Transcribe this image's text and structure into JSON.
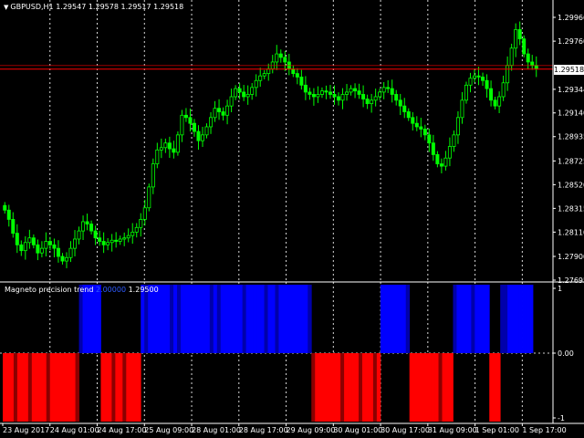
{
  "header": {
    "symbol": "GBPUSD,H1",
    "open": "1.29547",
    "high": "1.29578",
    "low": "1.29517",
    "close": "1.29518"
  },
  "indicator": {
    "name": "Magneto precision trend",
    "value1": "2.00000",
    "value2": "1.29500"
  },
  "current_price": "1.29518",
  "colors": {
    "background": "#000000",
    "bull_candle": "#00ff00",
    "bear_candle": "#00ff00",
    "grid": "#ffffff",
    "bid_line": "#ff0000",
    "up_bar": "#0000ff",
    "up_bar_dark": "#0000aa",
    "down_bar": "#ff0000",
    "down_bar_dark": "#8b0000"
  },
  "chart_data": [
    {
      "type": "candlestick",
      "title": "GBPUSD,H1",
      "y_ticks": [
        "1.29966",
        "1.29760",
        "1.29518",
        "1.29344",
        "1.29140",
        "1.28935",
        "1.28725",
        "1.28520",
        "1.28315",
        "1.28110",
        "1.27900",
        "1.27695"
      ],
      "y_tick_values": [
        1.29966,
        1.2976,
        1.29344,
        1.2914,
        1.28935,
        1.28725,
        1.2852,
        1.28315,
        1.2811,
        1.279,
        1.27695
      ],
      "ylim": [
        1.27695,
        1.301
      ],
      "x_labels": [
        "23 Aug 2017",
        "24 Aug 01:00",
        "24 Aug 17:00",
        "25 Aug 09:00",
        "28 Aug 01:00",
        "28 Aug 17:00",
        "29 Aug 09:00",
        "30 Aug 01:00",
        "30 Aug 17:00",
        "31 Aug 09:00",
        "1 Sep 01:00",
        "1 Sep 17:00"
      ],
      "bid_price": 1.29518,
      "close": [
        1.283,
        1.2822,
        1.281,
        1.28,
        1.2795,
        1.2802,
        1.2806,
        1.28,
        1.2793,
        1.2797,
        1.2803,
        1.28,
        1.2797,
        1.279,
        1.2786,
        1.2789,
        1.2797,
        1.2805,
        1.2812,
        1.282,
        1.2818,
        1.2812,
        1.2806,
        1.2803,
        1.28,
        1.2802,
        1.2804,
        1.2803,
        1.2805,
        1.2806,
        1.2808,
        1.2811,
        1.2815,
        1.2822,
        1.2832,
        1.285,
        1.287,
        1.2882,
        1.2884,
        1.2888,
        1.2883,
        1.288,
        1.2895,
        1.2912,
        1.291,
        1.2905,
        1.2898,
        1.289,
        1.2895,
        1.2902,
        1.291,
        1.2918,
        1.2915,
        1.2912,
        1.292,
        1.2928,
        1.2935,
        1.2932,
        1.2928,
        1.293,
        1.2936,
        1.2942,
        1.2946,
        1.2948,
        1.2952,
        1.2958,
        1.2965,
        1.2962,
        1.2958,
        1.2952,
        1.2948,
        1.2945,
        1.2938,
        1.2932,
        1.293,
        1.2928,
        1.293,
        1.2933,
        1.2932,
        1.293,
        1.2928,
        1.2925,
        1.293,
        1.2932,
        1.2935,
        1.2933,
        1.293,
        1.2926,
        1.2922,
        1.2925,
        1.2928,
        1.2932,
        1.2936,
        1.2935,
        1.293,
        1.2925,
        1.292,
        1.2915,
        1.291,
        1.2905,
        1.2902,
        1.29,
        1.2895,
        1.2888,
        1.2878,
        1.287,
        1.2868,
        1.2875,
        1.2885,
        1.2895,
        1.291,
        1.2925,
        1.2938,
        1.2944,
        1.2946,
        1.2945,
        1.2942,
        1.2935,
        1.2925,
        1.292,
        1.2928,
        1.294,
        1.2955,
        1.297,
        1.2986,
        1.2978,
        1.2965,
        1.2958,
        1.2955,
        1.2952
      ]
    },
    {
      "type": "histogram",
      "title": "Magneto precision trend",
      "y_ticks": [
        "1",
        "0.00",
        "-1"
      ],
      "ylim": [
        -1,
        1
      ],
      "values": [
        -1,
        -1,
        -1,
        -1,
        -1,
        -1,
        -1,
        -1,
        -1,
        -1,
        -1,
        -1,
        -1,
        -1,
        -1,
        -1,
        -1,
        -1,
        -1,
        -1,
        -1,
        1,
        1,
        1,
        1,
        1,
        1,
        -1,
        -1,
        -1,
        -1,
        -1,
        -1,
        -1,
        -1,
        -1,
        -1,
        -1,
        1,
        1,
        1,
        1,
        1,
        1,
        1,
        1,
        1,
        1,
        1,
        1,
        1,
        1,
        1,
        1,
        1,
        1,
        1,
        1,
        1,
        1,
        1,
        1,
        1,
        1,
        1,
        1,
        1,
        1,
        1,
        1,
        1,
        1,
        1,
        1,
        1,
        1,
        1,
        1,
        1,
        1,
        1,
        1,
        1,
        1,
        1,
        -1,
        -1,
        -1,
        -1,
        -1,
        -1,
        -1,
        -1,
        -1,
        -1,
        -1,
        -1,
        -1,
        -1,
        -1,
        -1,
        -1,
        -1,
        -1,
        1,
        1,
        1,
        1,
        1,
        1,
        1,
        1,
        -1,
        -1,
        -1,
        -1,
        -1,
        -1,
        -1,
        -1,
        -1,
        -1,
        -1,
        -1,
        1,
        1,
        1,
        1,
        1,
        1,
        1,
        1,
        1,
        1,
        -1,
        -1,
        -1,
        1,
        1,
        1,
        1,
        1,
        1,
        1,
        1,
        1
      ]
    }
  ]
}
